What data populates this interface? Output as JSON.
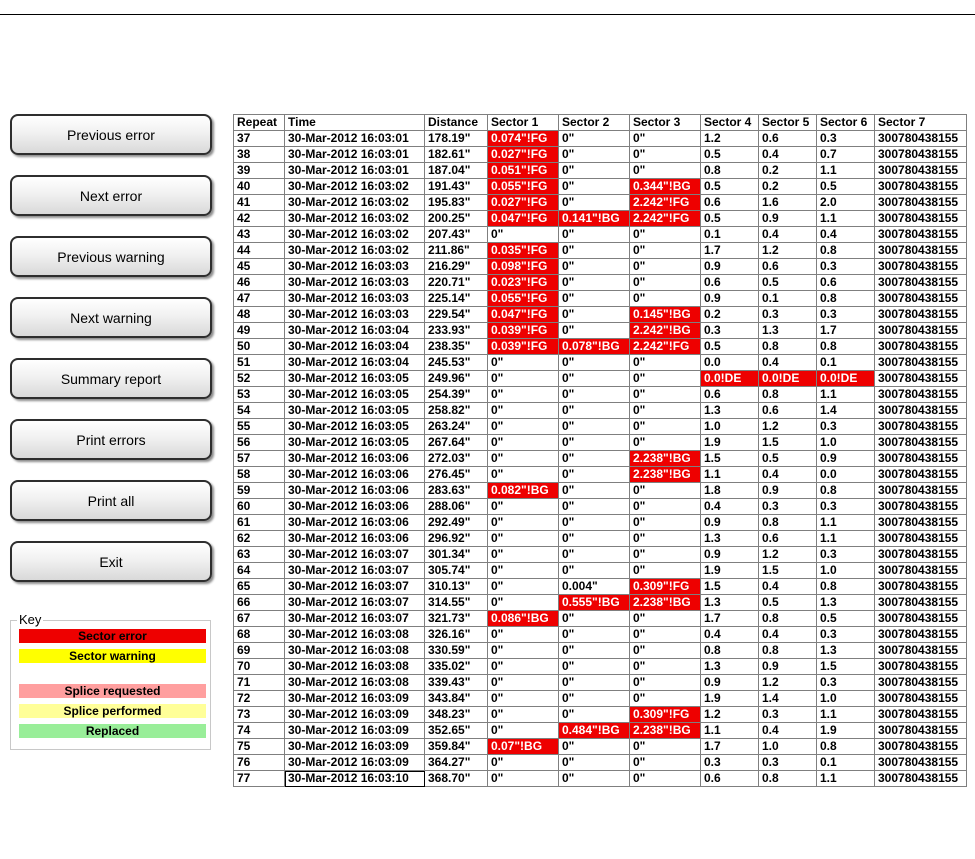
{
  "buttons": [
    {
      "id": "previous-error",
      "label": "Previous error"
    },
    {
      "id": "next-error",
      "label": "Next error"
    },
    {
      "id": "previous-warning",
      "label": "Previous warning"
    },
    {
      "id": "next-warning",
      "label": "Next warning"
    },
    {
      "id": "summary-report",
      "label": "Summary report"
    },
    {
      "id": "print-errors",
      "label": "Print errors"
    },
    {
      "id": "print-all",
      "label": "Print all"
    },
    {
      "id": "exit",
      "label": "Exit"
    }
  ],
  "key": {
    "title": "Key",
    "items": [
      {
        "label": "Sector error",
        "color": "#ee0000"
      },
      {
        "label": "Sector warning",
        "color": "#ffff00"
      },
      {
        "label": "Splice requested",
        "color": "#ff9f9f"
      },
      {
        "label": "Splice performed",
        "color": "#ffff99"
      },
      {
        "label": "Replaced",
        "color": "#99ee99"
      }
    ]
  },
  "table": {
    "columns": [
      "Repeat",
      "Time",
      "Distance",
      "Sector 1",
      "Sector 2",
      "Sector 3",
      "Sector 4",
      "Sector 5",
      "Sector 6",
      "Sector 7"
    ],
    "rows": [
      {
        "cells": [
          "37",
          "30-Mar-2012 16:03:01",
          "178.19\"",
          "0.074\"!FG",
          "0\"",
          "0\"",
          "1.2",
          "0.6",
          "0.3",
          "300780438155"
        ],
        "errors": [
          3
        ]
      },
      {
        "cells": [
          "38",
          "30-Mar-2012 16:03:01",
          "182.61\"",
          "0.027\"!FG",
          "0\"",
          "0\"",
          "0.5",
          "0.4",
          "0.7",
          "300780438155"
        ],
        "errors": [
          3
        ]
      },
      {
        "cells": [
          "39",
          "30-Mar-2012 16:03:01",
          "187.04\"",
          "0.051\"!FG",
          "0\"",
          "0\"",
          "0.8",
          "0.2",
          "1.1",
          "300780438155"
        ],
        "errors": [
          3
        ]
      },
      {
        "cells": [
          "40",
          "30-Mar-2012 16:03:02",
          "191.43\"",
          "0.055\"!FG",
          "0\"",
          "0.344\"!BG",
          "0.5",
          "0.2",
          "0.5",
          "300780438155"
        ],
        "errors": [
          3,
          5
        ]
      },
      {
        "cells": [
          "41",
          "30-Mar-2012 16:03:02",
          "195.83\"",
          "0.027\"!FG",
          "0\"",
          "2.242\"!FG",
          "0.6",
          "1.6",
          "2.0",
          "300780438155"
        ],
        "errors": [
          3,
          5
        ]
      },
      {
        "cells": [
          "42",
          "30-Mar-2012 16:03:02",
          "200.25\"",
          "0.047\"!FG",
          "0.141\"!BG",
          "2.242\"!FG",
          "0.5",
          "0.9",
          "1.1",
          "300780438155"
        ],
        "errors": [
          3,
          4,
          5
        ]
      },
      {
        "cells": [
          "43",
          "30-Mar-2012 16:03:02",
          "207.43\"",
          "0\"",
          "0\"",
          "0\"",
          "0.1",
          "0.4",
          "0.4",
          "300780438155"
        ],
        "errors": []
      },
      {
        "cells": [
          "44",
          "30-Mar-2012 16:03:02",
          "211.86\"",
          "0.035\"!FG",
          "0\"",
          "0\"",
          "1.7",
          "1.2",
          "0.8",
          "300780438155"
        ],
        "errors": [
          3
        ]
      },
      {
        "cells": [
          "45",
          "30-Mar-2012 16:03:03",
          "216.29\"",
          "0.098\"!FG",
          "0\"",
          "0\"",
          "0.9",
          "0.6",
          "0.3",
          "300780438155"
        ],
        "errors": [
          3
        ]
      },
      {
        "cells": [
          "46",
          "30-Mar-2012 16:03:03",
          "220.71\"",
          "0.023\"!FG",
          "0\"",
          "0\"",
          "0.6",
          "0.5",
          "0.6",
          "300780438155"
        ],
        "errors": [
          3
        ]
      },
      {
        "cells": [
          "47",
          "30-Mar-2012 16:03:03",
          "225.14\"",
          "0.055\"!FG",
          "0\"",
          "0\"",
          "0.9",
          "0.1",
          "0.8",
          "300780438155"
        ],
        "errors": [
          3
        ]
      },
      {
        "cells": [
          "48",
          "30-Mar-2012 16:03:03",
          "229.54\"",
          "0.047\"!FG",
          "0\"",
          "0.145\"!BG",
          "0.2",
          "0.3",
          "0.3",
          "300780438155"
        ],
        "errors": [
          3,
          5
        ]
      },
      {
        "cells": [
          "49",
          "30-Mar-2012 16:03:04",
          "233.93\"",
          "0.039\"!FG",
          "0\"",
          "2.242\"!BG",
          "0.3",
          "1.3",
          "1.7",
          "300780438155"
        ],
        "errors": [
          3,
          5
        ]
      },
      {
        "cells": [
          "50",
          "30-Mar-2012 16:03:04",
          "238.35\"",
          "0.039\"!FG",
          "0.078\"!BG",
          "2.242\"!FG",
          "0.5",
          "0.8",
          "0.8",
          "300780438155"
        ],
        "errors": [
          3,
          4,
          5
        ]
      },
      {
        "cells": [
          "51",
          "30-Mar-2012 16:03:04",
          "245.53\"",
          "0\"",
          "0\"",
          "0\"",
          "0.0",
          "0.4",
          "0.1",
          "300780438155"
        ],
        "errors": []
      },
      {
        "cells": [
          "52",
          "30-Mar-2012 16:03:05",
          "249.96\"",
          "0\"",
          "0\"",
          "0\"",
          "0.0!DE",
          "0.0!DE",
          "0.0!DE",
          "300780438155"
        ],
        "errors": [
          6,
          7,
          8
        ]
      },
      {
        "cells": [
          "53",
          "30-Mar-2012 16:03:05",
          "254.39\"",
          "0\"",
          "0\"",
          "0\"",
          "0.6",
          "0.8",
          "1.1",
          "300780438155"
        ],
        "errors": []
      },
      {
        "cells": [
          "54",
          "30-Mar-2012 16:03:05",
          "258.82\"",
          "0\"",
          "0\"",
          "0\"",
          "1.3",
          "0.6",
          "1.4",
          "300780438155"
        ],
        "errors": []
      },
      {
        "cells": [
          "55",
          "30-Mar-2012 16:03:05",
          "263.24\"",
          "0\"",
          "0\"",
          "0\"",
          "1.0",
          "1.2",
          "0.3",
          "300780438155"
        ],
        "errors": []
      },
      {
        "cells": [
          "56",
          "30-Mar-2012 16:03:05",
          "267.64\"",
          "0\"",
          "0\"",
          "0\"",
          "1.9",
          "1.5",
          "1.0",
          "300780438155"
        ],
        "errors": []
      },
      {
        "cells": [
          "57",
          "30-Mar-2012 16:03:06",
          "272.03\"",
          "0\"",
          "0\"",
          "2.238\"!BG",
          "1.5",
          "0.5",
          "0.9",
          "300780438155"
        ],
        "errors": [
          5
        ]
      },
      {
        "cells": [
          "58",
          "30-Mar-2012 16:03:06",
          "276.45\"",
          "0\"",
          "0\"",
          "2.238\"!BG",
          "1.1",
          "0.4",
          "0.0",
          "300780438155"
        ],
        "errors": [
          5
        ]
      },
      {
        "cells": [
          "59",
          "30-Mar-2012 16:03:06",
          "283.63\"",
          "0.082\"!BG",
          "0\"",
          "0\"",
          "1.8",
          "0.9",
          "0.8",
          "300780438155"
        ],
        "errors": [
          3
        ]
      },
      {
        "cells": [
          "60",
          "30-Mar-2012 16:03:06",
          "288.06\"",
          "0\"",
          "0\"",
          "0\"",
          "0.4",
          "0.3",
          "0.3",
          "300780438155"
        ],
        "errors": []
      },
      {
        "cells": [
          "61",
          "30-Mar-2012 16:03:06",
          "292.49\"",
          "0\"",
          "0\"",
          "0\"",
          "0.9",
          "0.8",
          "1.1",
          "300780438155"
        ],
        "errors": []
      },
      {
        "cells": [
          "62",
          "30-Mar-2012 16:03:06",
          "296.92\"",
          "0\"",
          "0\"",
          "0\"",
          "1.3",
          "0.6",
          "1.1",
          "300780438155"
        ],
        "errors": []
      },
      {
        "cells": [
          "63",
          "30-Mar-2012 16:03:07",
          "301.34\"",
          "0\"",
          "0\"",
          "0\"",
          "0.9",
          "1.2",
          "0.3",
          "300780438155"
        ],
        "errors": []
      },
      {
        "cells": [
          "64",
          "30-Mar-2012 16:03:07",
          "305.74\"",
          "0\"",
          "0\"",
          "0\"",
          "1.9",
          "1.5",
          "1.0",
          "300780438155"
        ],
        "errors": []
      },
      {
        "cells": [
          "65",
          "30-Mar-2012 16:03:07",
          "310.13\"",
          "0\"",
          "0.004\"",
          "0.309\"!FG",
          "1.5",
          "0.4",
          "0.8",
          "300780438155"
        ],
        "errors": [
          5
        ]
      },
      {
        "cells": [
          "66",
          "30-Mar-2012 16:03:07",
          "314.55\"",
          "0\"",
          "0.555\"!BG",
          "2.238\"!BG",
          "1.3",
          "0.5",
          "1.3",
          "300780438155"
        ],
        "errors": [
          4,
          5
        ]
      },
      {
        "cells": [
          "67",
          "30-Mar-2012 16:03:07",
          "321.73\"",
          "0.086\"!BG",
          "0\"",
          "0\"",
          "1.7",
          "0.8",
          "0.5",
          "300780438155"
        ],
        "errors": [
          3
        ]
      },
      {
        "cells": [
          "68",
          "30-Mar-2012 16:03:08",
          "326.16\"",
          "0\"",
          "0\"",
          "0\"",
          "0.4",
          "0.4",
          "0.3",
          "300780438155"
        ],
        "errors": []
      },
      {
        "cells": [
          "69",
          "30-Mar-2012 16:03:08",
          "330.59\"",
          "0\"",
          "0\"",
          "0\"",
          "0.8",
          "0.8",
          "1.3",
          "300780438155"
        ],
        "errors": []
      },
      {
        "cells": [
          "70",
          "30-Mar-2012 16:03:08",
          "335.02\"",
          "0\"",
          "0\"",
          "0\"",
          "1.3",
          "0.9",
          "1.5",
          "300780438155"
        ],
        "errors": []
      },
      {
        "cells": [
          "71",
          "30-Mar-2012 16:03:08",
          "339.43\"",
          "0\"",
          "0\"",
          "0\"",
          "0.9",
          "1.2",
          "0.3",
          "300780438155"
        ],
        "errors": []
      },
      {
        "cells": [
          "72",
          "30-Mar-2012 16:03:09",
          "343.84\"",
          "0\"",
          "0\"",
          "0\"",
          "1.9",
          "1.4",
          "1.0",
          "300780438155"
        ],
        "errors": []
      },
      {
        "cells": [
          "73",
          "30-Mar-2012 16:03:09",
          "348.23\"",
          "0\"",
          "0\"",
          "0.309\"!FG",
          "1.2",
          "0.3",
          "1.1",
          "300780438155"
        ],
        "errors": [
          5
        ]
      },
      {
        "cells": [
          "74",
          "30-Mar-2012 16:03:09",
          "352.65\"",
          "0\"",
          "0.484\"!BG",
          "2.238\"!BG",
          "1.1",
          "0.4",
          "1.9",
          "300780438155"
        ],
        "errors": [
          4,
          5
        ]
      },
      {
        "cells": [
          "75",
          "30-Mar-2012 16:03:09",
          "359.84\"",
          "0.07\"!BG",
          "0\"",
          "0\"",
          "1.7",
          "1.0",
          "0.8",
          "300780438155"
        ],
        "errors": [
          3
        ]
      },
      {
        "cells": [
          "76",
          "30-Mar-2012 16:03:09",
          "364.27\"",
          "0\"",
          "0\"",
          "0\"",
          "0.3",
          "0.3",
          "0.1",
          "300780438155"
        ],
        "errors": []
      },
      {
        "cells": [
          "77",
          "30-Mar-2012 16:03:10",
          "368.70\"",
          "0\"",
          "0\"",
          "0\"",
          "0.6",
          "0.8",
          "1.1",
          "300780438155"
        ],
        "errors": [],
        "selected": [
          1
        ]
      }
    ]
  }
}
